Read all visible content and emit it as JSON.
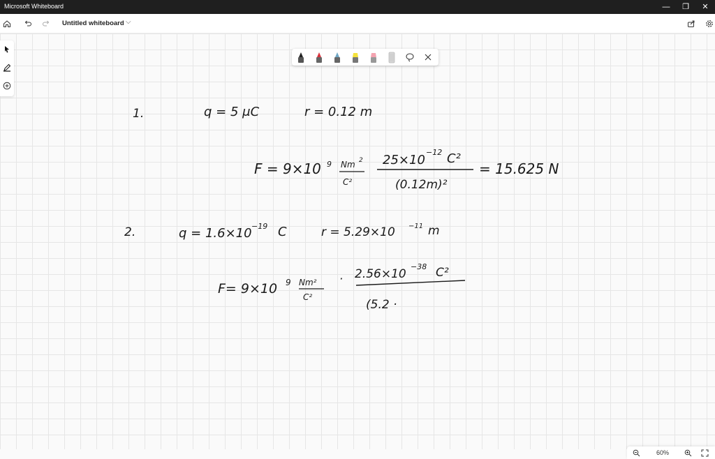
{
  "window": {
    "app_title": "Microsoft Whiteboard",
    "minimize_glyph": "—",
    "restore_glyph": "❐",
    "close_glyph": "✕"
  },
  "toolbar": {
    "doc_title": "Untitled whiteboard",
    "chevron": "⌵"
  },
  "zoom": {
    "level": "60%"
  },
  "pens": [
    {
      "name": "black-pen",
      "color": "#222222"
    },
    {
      "name": "red-pen",
      "color": "#d8323c"
    },
    {
      "name": "blue-pen",
      "color": "#6fa6c4"
    },
    {
      "name": "yellow-highlighter",
      "color": "#f5e33c"
    },
    {
      "name": "pink-highlighter",
      "color": "#f4a3b0"
    },
    {
      "name": "eraser",
      "color": "#d0d0d0"
    }
  ],
  "ink": {
    "p1_number": "1.",
    "p1_q": "q = 5 μC",
    "p1_r": "r = 0.12 m",
    "p1_F": "F = 9×10",
    "p1_exp9": "9",
    "p1_Nm": "Nm",
    "p1_Nm_exp": "2",
    "p1_C2": "C²",
    "p1_num": "25×10",
    "p1_num_exp": "−12",
    "p1_num_C": "C²",
    "p1_den": "(0.12m)²",
    "p1_result": "= 15.625 N",
    "p2_number": "2.",
    "p2_q": "q = 1.6×10",
    "p2_q_exp": "−19",
    "p2_q_C": "C",
    "p2_r": "r = 5.29×10",
    "p2_r_exp": "−11",
    "p2_r_m": "m",
    "p2_F": "F= 9×10",
    "p2_exp9": "9",
    "p2_Nm": "Nm²",
    "p2_C2": "C²",
    "p2_dot": "·",
    "p2_num": "2.56×10",
    "p2_num_exp": "−38",
    "p2_num_C": "C²",
    "p2_den": "(5.2 ·"
  }
}
